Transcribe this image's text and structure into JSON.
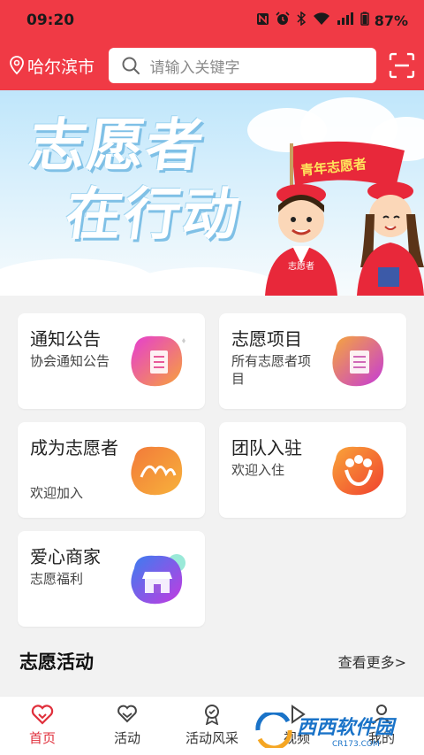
{
  "status": {
    "time": "09:20",
    "battery": "87%"
  },
  "header": {
    "location": "哈尔滨市",
    "search_placeholder": "请输入关键字"
  },
  "banner": {
    "line1": "志愿者",
    "line2": "在行动",
    "flag_text": "青年志愿者",
    "badge_text": "志愿者"
  },
  "cards": [
    {
      "title": "通知公告",
      "subtitle": "协会通知公告",
      "icon": "document-icon"
    },
    {
      "title": "志愿项目",
      "subtitle": "所有志愿者项目",
      "icon": "list-icon"
    },
    {
      "title": "成为志愿者",
      "subtitle": "欢迎加入",
      "icon": "volunteer-icon"
    },
    {
      "title": "团队入驻",
      "subtitle": "欢迎入住",
      "icon": "team-icon"
    },
    {
      "title": "爱心商家",
      "subtitle": "志愿福利",
      "icon": "shop-icon"
    }
  ],
  "section": {
    "title": "志愿活动",
    "more": "查看更多>"
  },
  "nav": [
    {
      "label": "首页",
      "icon": "heart-home-icon",
      "active": true
    },
    {
      "label": "活动",
      "icon": "heart-hands-icon",
      "active": false
    },
    {
      "label": "活动风采",
      "icon": "award-icon",
      "active": false
    },
    {
      "label": "视频",
      "icon": "play-icon",
      "active": false
    },
    {
      "label": "我的",
      "icon": "user-icon",
      "active": false
    }
  ],
  "watermark": {
    "main": "西西软件园",
    "sub": "CR173.COM"
  },
  "colors": {
    "brand_red": "#f03a45",
    "active_red": "#e0303c"
  }
}
